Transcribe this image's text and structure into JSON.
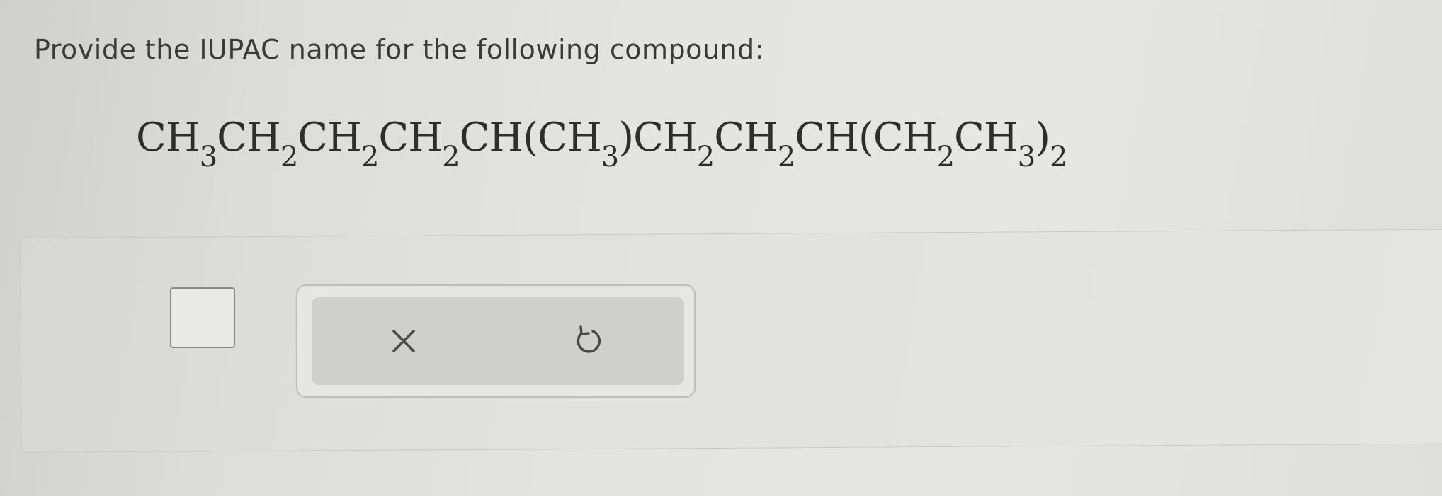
{
  "question": {
    "prompt": "Provide the IUPAC name for the following compound:"
  },
  "formula": {
    "segments": [
      {
        "text": "CH",
        "sub": "3"
      },
      {
        "text": "CH",
        "sub": "2"
      },
      {
        "text": "CH",
        "sub": "2"
      },
      {
        "text": "CH",
        "sub": "2"
      },
      {
        "text": "CH(CH",
        "sub": "3"
      },
      {
        "text": ")CH",
        "sub": "2"
      },
      {
        "text": "CH",
        "sub": "2"
      },
      {
        "text": "CH(CH",
        "sub": "2"
      },
      {
        "text": "CH",
        "sub": "3"
      },
      {
        "text": ")",
        "sub": "2"
      }
    ]
  },
  "answer": {
    "value": ""
  },
  "toolbar": {
    "icons": [
      "close-icon",
      "undo-icon"
    ]
  }
}
